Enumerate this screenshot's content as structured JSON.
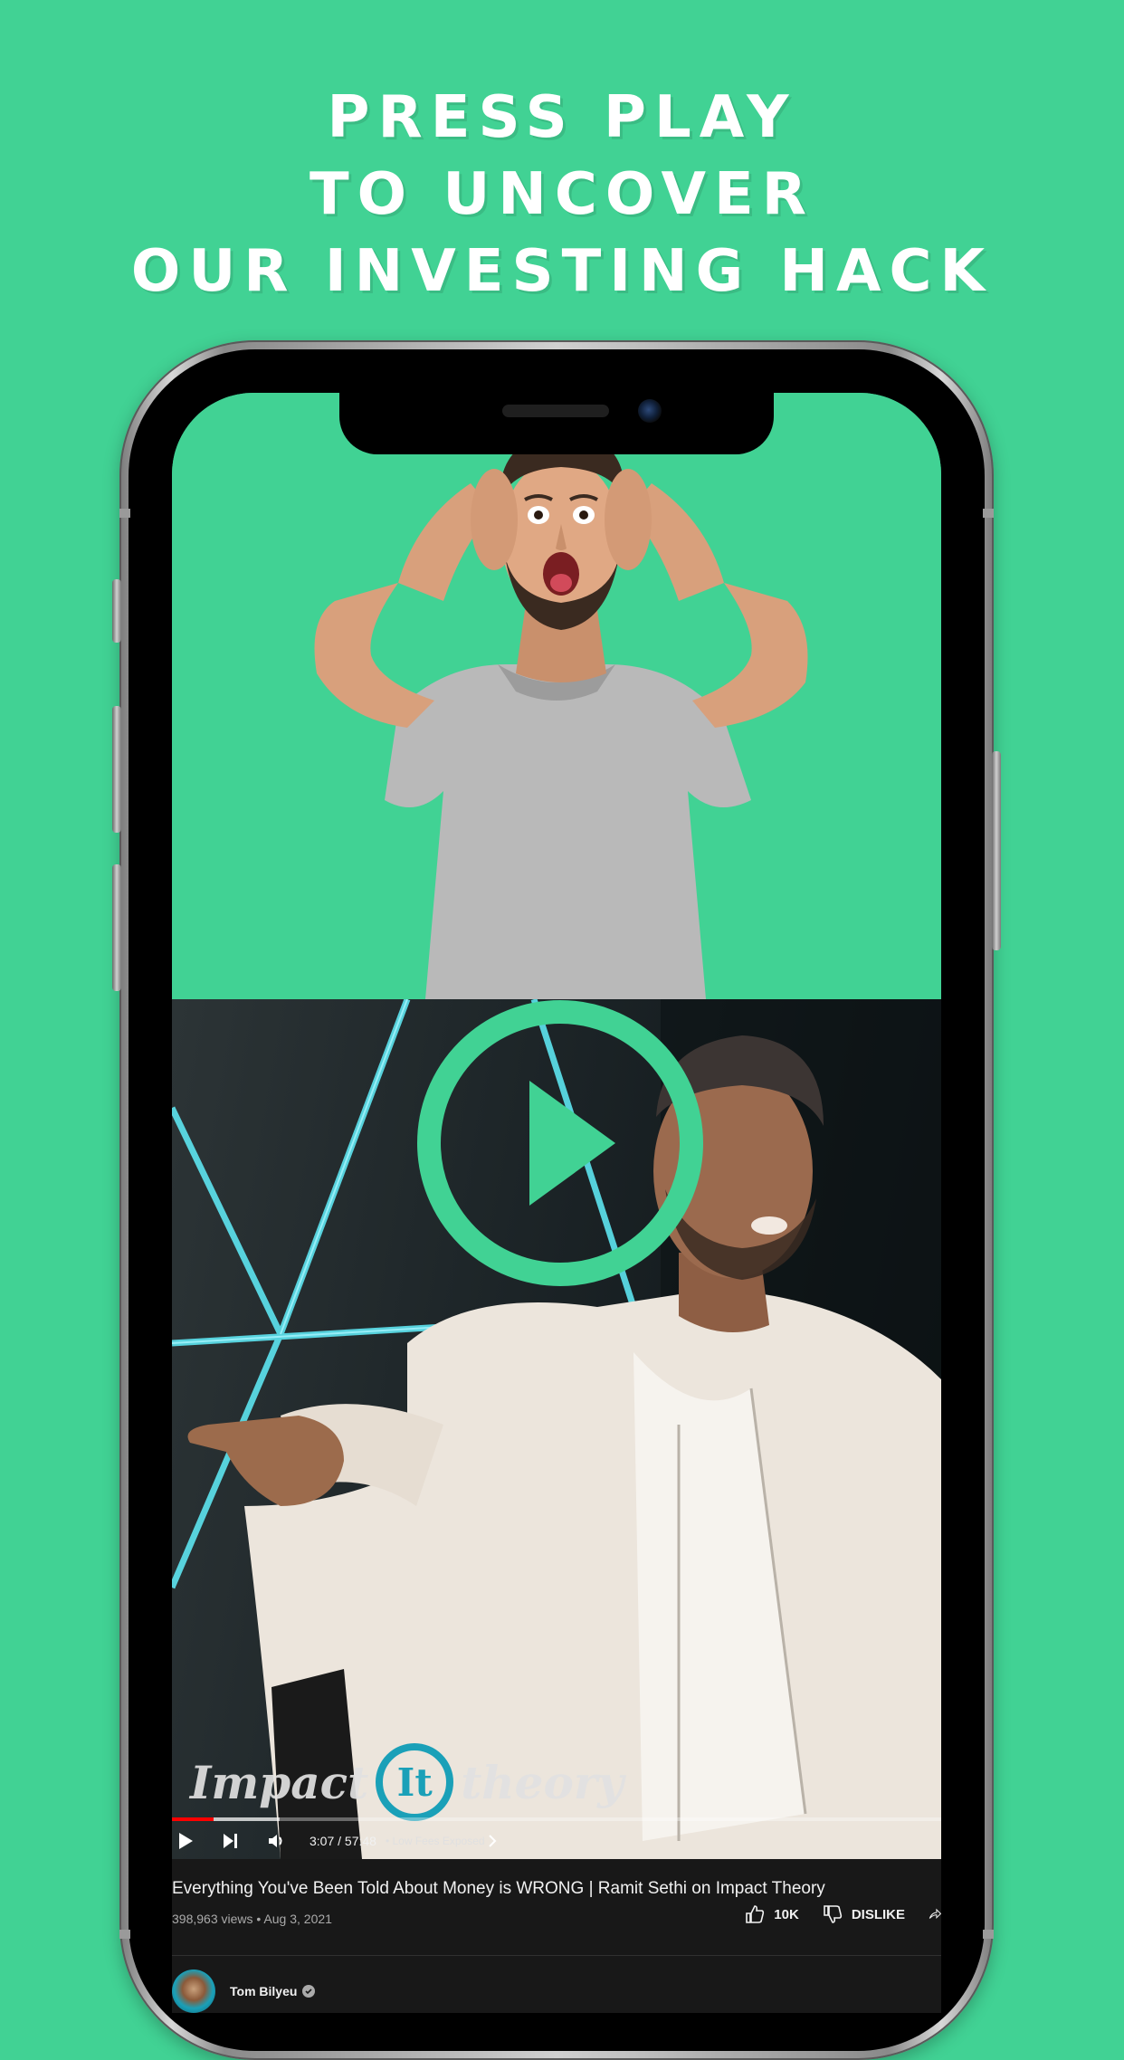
{
  "headline": {
    "line1": "PRESS PLAY",
    "line2": "TO UNCOVER",
    "line3": "OUR INVESTING HACK"
  },
  "colors": {
    "background": "#41d294",
    "accent": "#41d294",
    "progress": "#ff0000",
    "info_bg": "#181818"
  },
  "video": {
    "watermark": {
      "left": "Impact",
      "badge": "It",
      "right": "theory"
    },
    "current_time": "3:07",
    "duration": "57:48",
    "time_display": "3:07 / 57:48",
    "chapter": "• Low Fees Exposed",
    "progress": 0.054,
    "buffered": 0.14,
    "icons": [
      "play-icon",
      "skip-next-icon",
      "volume-icon",
      "chevron-right-icon",
      "big-play-icon"
    ]
  },
  "info": {
    "title": "Everything You've Been Told About Money is WRONG | Ramit Sethi on Impact Theory",
    "views": "398,963 views",
    "date": "Aug 3, 2021",
    "meta_text": "398,963 views • Aug 3, 2021",
    "like_count": "10K",
    "dislike_label": "DISLIKE",
    "channel_name": "Tom Bilyeu"
  }
}
